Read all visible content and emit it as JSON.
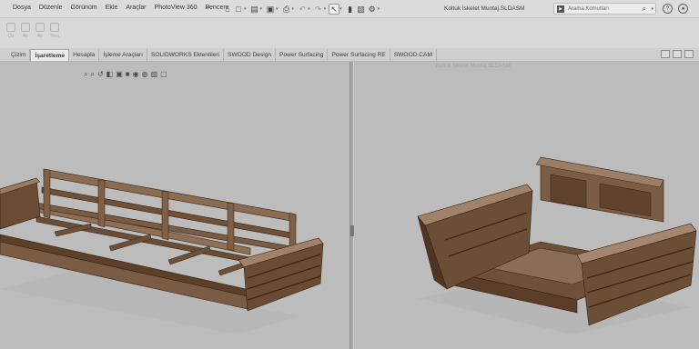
{
  "menu": [
    "Dosya",
    "Düzenle",
    "Görünüm",
    "Ekle",
    "Araçlar",
    "PhotoView 360",
    "Pencere"
  ],
  "quick_access_icons": [
    "home-icon",
    "new-document-icon",
    "open-folder-icon",
    "save-icon",
    "print-icon",
    "undo-icon",
    "redo-icon",
    "select-cursor-icon",
    "traffic-light-icon",
    "file-properties-icon",
    "options-gear-icon"
  ],
  "document_title": "Koltuk İskelet Montaj.SLDASM",
  "search": {
    "placeholder": "Arama Komutları"
  },
  "ribbon": {
    "tools": [
      {
        "label": "Çiz",
        "icon": "sketch-icon"
      },
      {
        "label": "Ak",
        "icon": "smart-dimension-icon"
      },
      {
        "label": "Ak",
        "icon": "entity-icon"
      },
      {
        "label": "Yeni",
        "icon": "new-sketch-icon"
      }
    ]
  },
  "tabs": [
    {
      "label": "Çizim",
      "active": false
    },
    {
      "label": "İşaretleme",
      "active": true
    },
    {
      "label": "Hesapla",
      "active": false
    },
    {
      "label": "İşleme Araçları",
      "active": false
    },
    {
      "label": "SOLIDWORKS Eklentileri",
      "active": false
    },
    {
      "label": "SWOOD Design",
      "active": false
    },
    {
      "label": "Power Surfacing",
      "active": false
    },
    {
      "label": "Power Surfacing RE",
      "active": false
    },
    {
      "label": "SWOOD CAM",
      "active": false
    }
  ],
  "viewport_left": {
    "hud_icons": [
      "zoom-to-fit-icon",
      "zoom-area-icon",
      "previous-view-icon",
      "section-view-icon",
      "view-orientation-icon",
      "display-style-icon",
      "hide-show-icon",
      "edit-appearance-icon",
      "scene-icon",
      "view-settings-icon"
    ]
  },
  "viewport_right": {
    "title": "Koltuk İskelet Montaj.SLDASM"
  },
  "colors": {
    "titlebar": "#dcdcdc",
    "ribbon": "#d9d9d9",
    "tabbar": "#cfcfcf",
    "viewport": "#bcbcbc",
    "wood_top": "#8a6d55",
    "wood_side": "#5a3e2a",
    "wood_edge": "#3a2616"
  }
}
